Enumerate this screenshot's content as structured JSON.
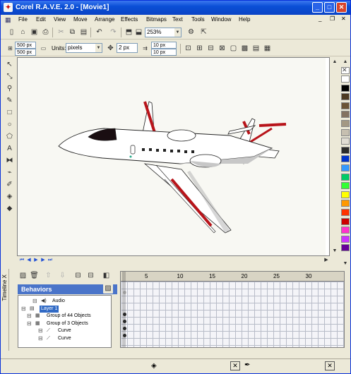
{
  "window": {
    "app_icon": "corel-rave-icon",
    "title": "Corel R.A.V.E. 2.0 - [Movie1]"
  },
  "menu": [
    "File",
    "Edit",
    "View",
    "Move",
    "Arrange",
    "Effects",
    "Bitmaps",
    "Text",
    "Tools",
    "Window",
    "Help"
  ],
  "toolbar": {
    "zoom": "253%"
  },
  "property_bar": {
    "width": "500 px",
    "height": "500 px",
    "units_label": "Units:",
    "units": "pixels",
    "nudge": "2 px",
    "dup_x": "10 px",
    "dup_y": "10 px"
  },
  "palette": [
    "#ffffff",
    "#000000",
    "#4d3a22",
    "#6b5436",
    "#837261",
    "#a39884",
    "#c6bfb0",
    "#e0dcd3",
    "#2a2a2a",
    "#0033cc",
    "#3399ff",
    "#00cc66",
    "#33ff33",
    "#ffff00",
    "#ff9900",
    "#ff3300",
    "#cc0000",
    "#ff33cc",
    "#cc33ff",
    "#660099"
  ],
  "timeline": {
    "tab_label": "Timeline X",
    "behaviors_label": "Behaviors",
    "tree": [
      {
        "indent": 2,
        "label": "Audio",
        "icon": "speaker-icon"
      },
      {
        "indent": 0,
        "label": "Layer 1",
        "icon": "layer-icon",
        "selected": true
      },
      {
        "indent": 1,
        "label": "Group of 44 Objects",
        "icon": "group-icon"
      },
      {
        "indent": 1,
        "label": "Group of 3 Objects",
        "icon": "group-icon"
      },
      {
        "indent": 3,
        "label": "Curve",
        "icon": "curve-icon"
      },
      {
        "indent": 3,
        "label": "Curve",
        "icon": "curve-icon"
      }
    ],
    "frames": [
      "5",
      "10",
      "15",
      "20",
      "25",
      "30"
    ]
  }
}
